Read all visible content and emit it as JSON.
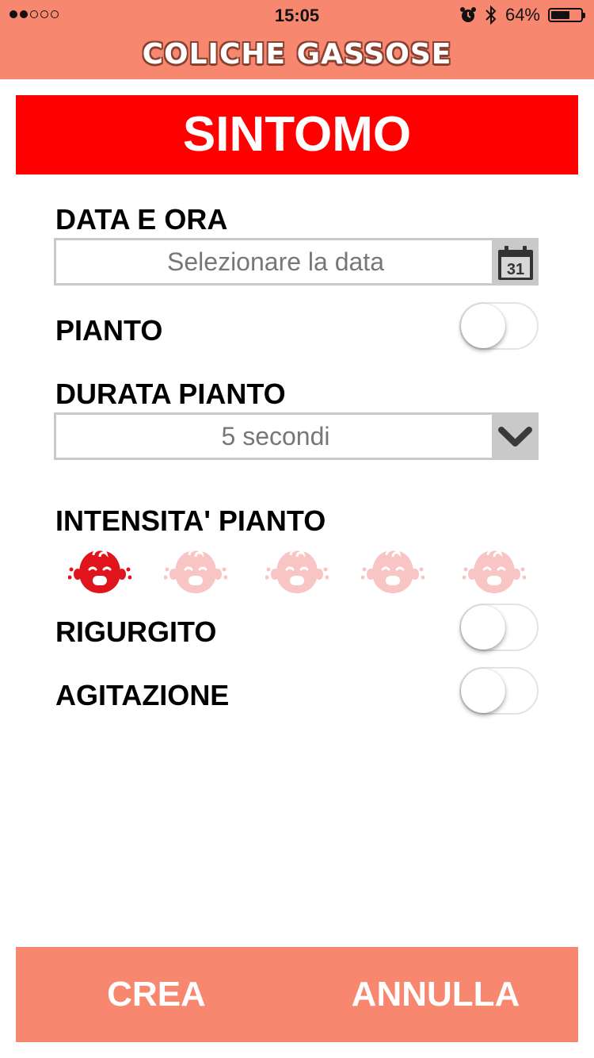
{
  "status_bar": {
    "time": "15:05",
    "battery_text": "64%",
    "battery_level": 0.64,
    "signal_dots": [
      true,
      true,
      false,
      false,
      false
    ]
  },
  "nav": {
    "title": "COLICHE GASSOSE"
  },
  "header": {
    "title": "SINTOMO"
  },
  "form": {
    "date_label": "DATA E ORA",
    "date_placeholder": "Selezionare la data",
    "calendar_day": "31",
    "crying_label": "PIANTO",
    "crying_on": false,
    "duration_label": "DURATA PIANTO",
    "duration_value": "5 secondi",
    "intensity_label": "INTENSITA' PIANTO",
    "intensity_value": 1,
    "intensity_max": 5,
    "regurgitation_label": "RIGURGITO",
    "regurgitation_on": false,
    "agitation_label": "AGITAZIONE",
    "agitation_on": false
  },
  "footer": {
    "create_label": "CREA",
    "cancel_label": "ANNULLA"
  },
  "colors": {
    "accent": "#f7876e",
    "header_red": "#ff0000",
    "face_active": "#e0141c",
    "face_inactive": "#f8c4c4",
    "field_gray": "#c9c9c9"
  }
}
